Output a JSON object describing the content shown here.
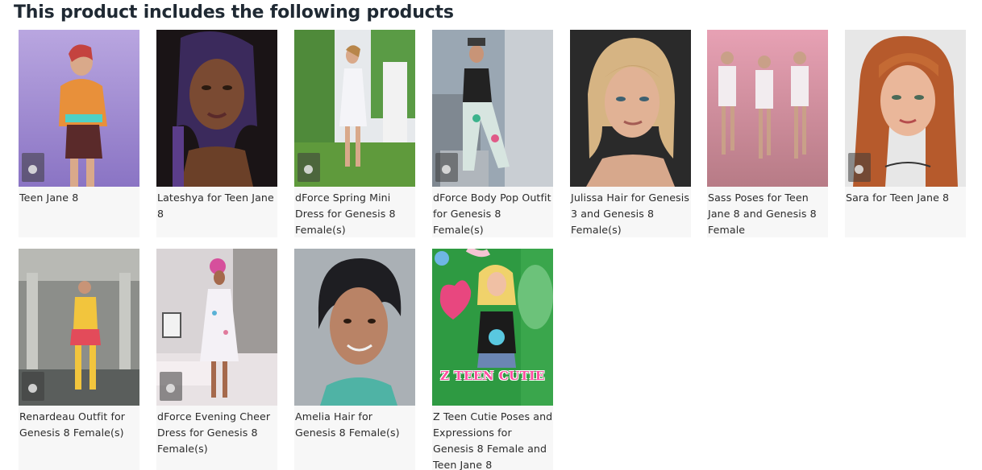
{
  "section": {
    "heading": "This product includes the following products"
  },
  "products": [
    {
      "title": "Teen Jane 8"
    },
    {
      "title": "Lateshya for Teen Jane 8"
    },
    {
      "title": "dForce Spring Mini Dress for Genesis 8 Female(s)"
    },
    {
      "title": "dForce Body Pop Outfit for Genesis 8 Female(s)"
    },
    {
      "title": "Julissa Hair for Genesis 3 and Genesis 8 Female(s)"
    },
    {
      "title": "Sass Poses for Teen Jane 8 and Genesis 8 Female"
    },
    {
      "title": "Sara for Teen Jane 8"
    },
    {
      "title": "Renardeau Outfit for Genesis 8 Female(s)"
    },
    {
      "title": "dForce Evening Cheer Dress for Genesis 8 Female(s)"
    },
    {
      "title": "Amelia Hair for Genesis 8 Female(s)"
    },
    {
      "title": "Z Teen Cutie Poses and Expressions for Genesis 8 Female and Teen Jane 8",
      "image_text": "Z TEEN CUTIE"
    }
  ]
}
